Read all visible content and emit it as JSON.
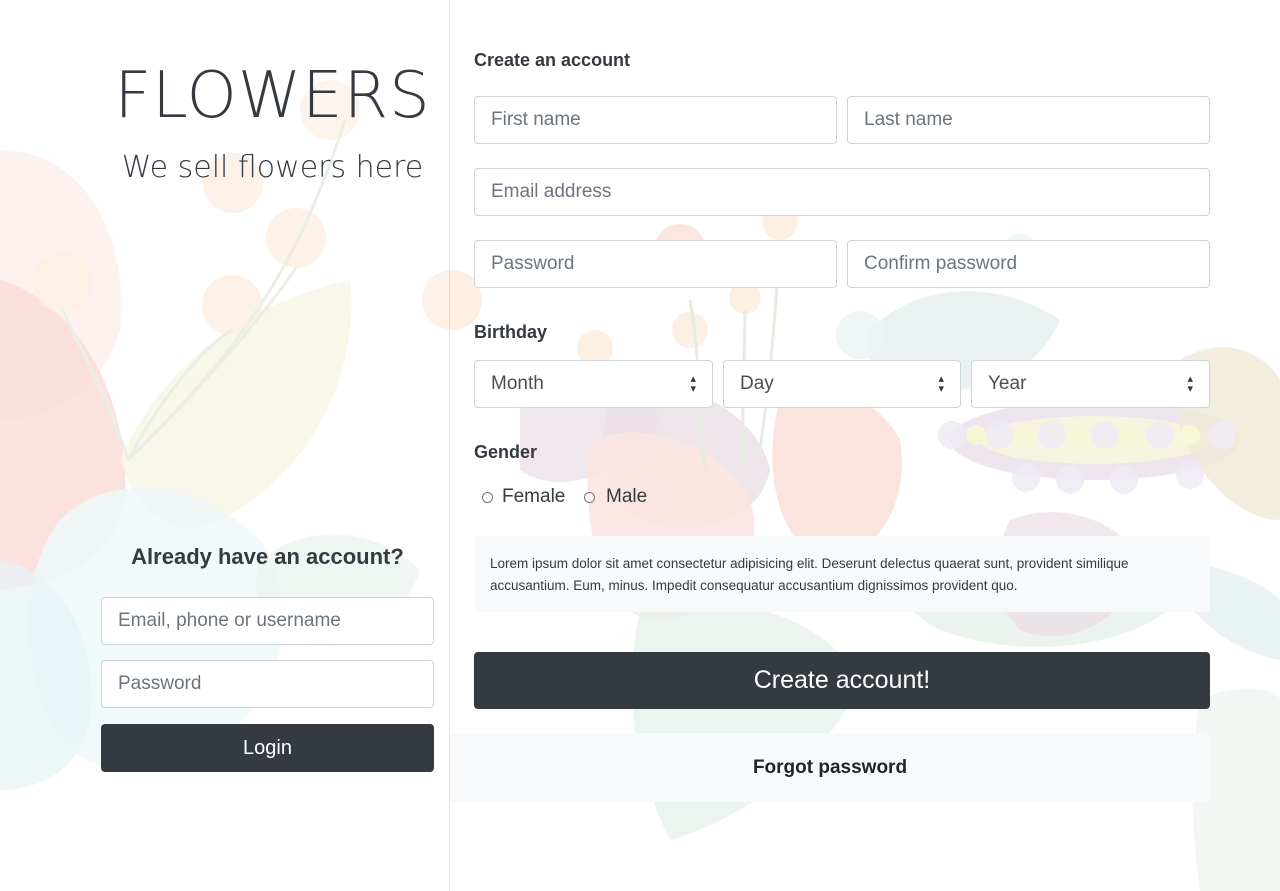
{
  "brand": {
    "title": "FLOWERS",
    "tagline": "We sell flowers here"
  },
  "login": {
    "heading": "Already have an account?",
    "username_placeholder": "Email, phone or username",
    "password_placeholder": "Password",
    "submit_label": "Login"
  },
  "signup": {
    "heading": "Create an account",
    "first_name_placeholder": "First name",
    "last_name_placeholder": "Last name",
    "email_placeholder": "Email address",
    "password_placeholder": "Password",
    "confirm_password_placeholder": "Confirm password",
    "birthday_label": "Birthday",
    "month_select": "Month",
    "day_select": "Day",
    "year_select": "Year",
    "gender_label": "Gender",
    "gender_options": [
      "Female",
      "Male"
    ],
    "terms_text": "Lorem ipsum dolor sit amet consectetur adipisicing elit. Deserunt delectus quaerat sunt, provident similique accusantium. Eum, minus. Impedit consequatur accusantium dignissimos provident quo.",
    "submit_label": "Create account!",
    "forgot_label": "Forgot password"
  },
  "colors": {
    "dark": "#343a40",
    "light": "#f8f9fa",
    "border": "#ced4da"
  },
  "icons": [
    "select-caret-icon",
    "radio-icon"
  ]
}
